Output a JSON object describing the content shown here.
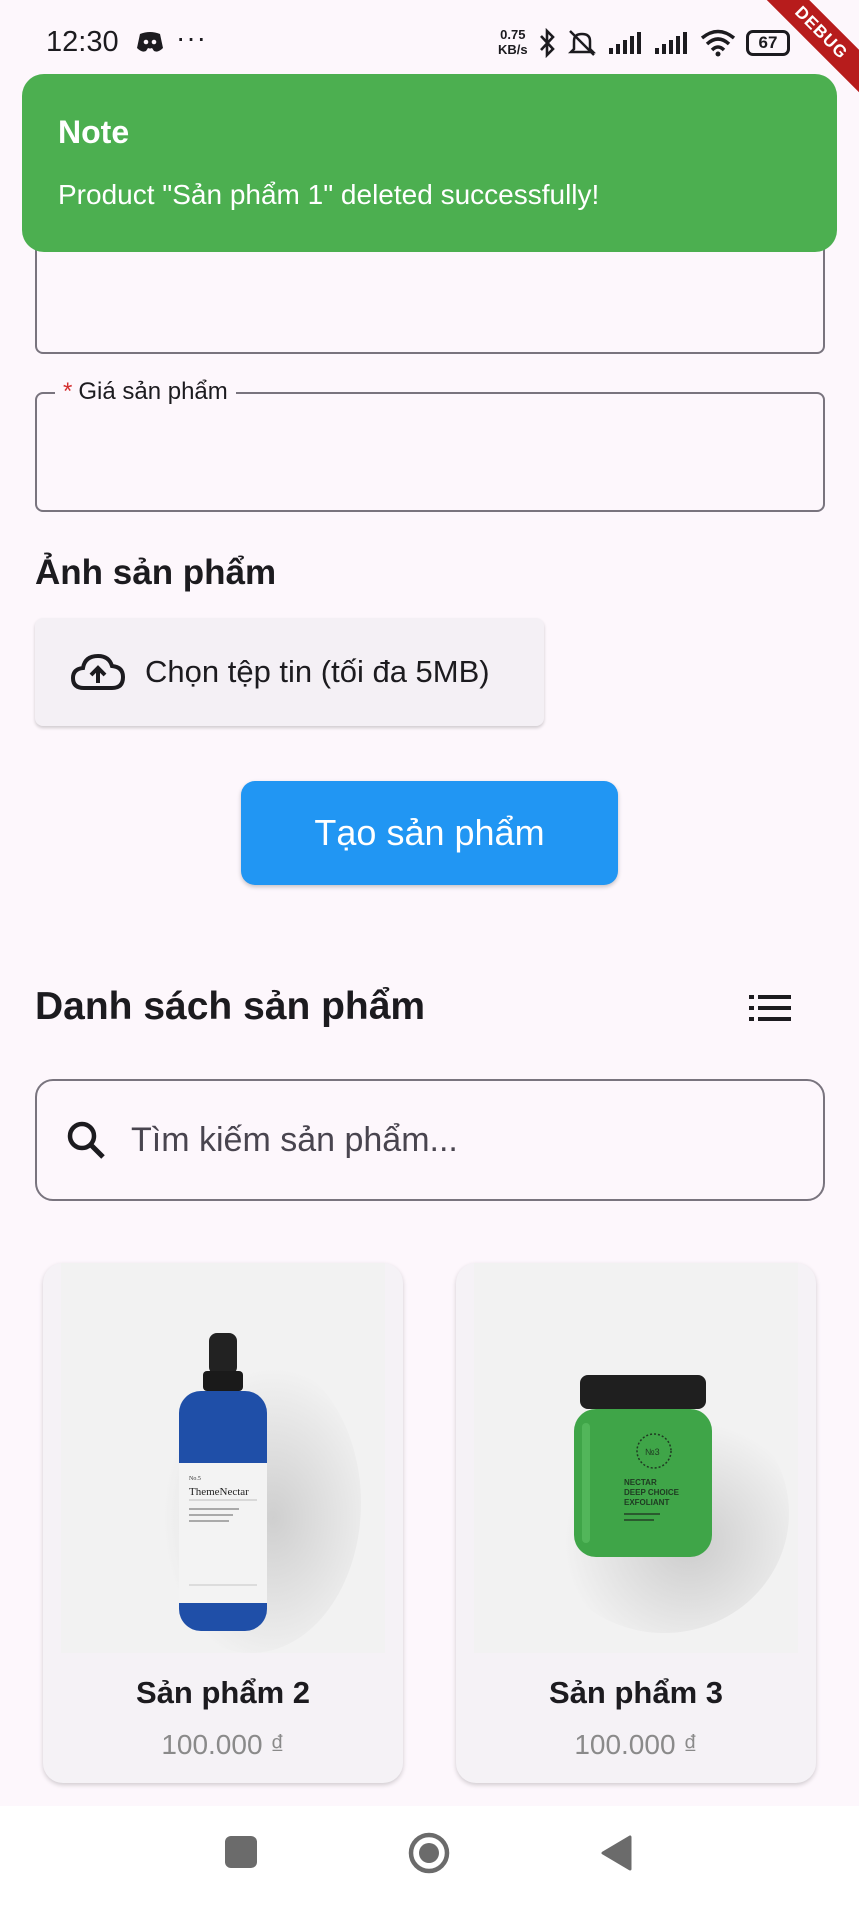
{
  "status_bar": {
    "time": "12:30",
    "dots": "···",
    "speed_value": "0.75",
    "speed_unit": "KB/s",
    "battery": "67",
    "icons": [
      "discord-icon",
      "bluetooth-icon",
      "bell-off-icon",
      "signal-icon",
      "signal-icon",
      "wifi-icon",
      "battery-icon"
    ]
  },
  "debug_banner": "DEBUG",
  "toast": {
    "title": "Note",
    "message": "Product \"Sản phẩm 1\" deleted successfully!",
    "color": "#4caf50"
  },
  "form": {
    "price_label": "Giá sản phẩm",
    "required_mark": "*",
    "image_heading": "Ảnh sản phẩm",
    "upload_label": "Chọn tệp tin (tối đa 5MB)",
    "create_button": "Tạo sản phẩm",
    "create_button_color": "#2196f3"
  },
  "product_list": {
    "heading": "Danh sách sản phẩm",
    "search_placeholder": "Tìm kiếm sản phẩm...",
    "items": [
      {
        "name": "Sản phẩm 2",
        "price": "100.000 ₫",
        "image": "blue dropper bottle ThemeNectar"
      },
      {
        "name": "Sản phẩm 3",
        "price": "100.000 ₫",
        "image": "green jar NECTAR DEEP CHOICE EXFOLIANT"
      }
    ]
  },
  "bottle_label": {
    "brand": "ThemeNectar",
    "no": "No.5"
  },
  "jar_label": {
    "line1": "NECTAR",
    "line2": "DEEP CHOICE",
    "line3": "EXFOLIANT",
    "badge": "№3"
  },
  "nav_bar": {
    "buttons": [
      "recent-apps-button",
      "home-button",
      "back-button"
    ]
  }
}
